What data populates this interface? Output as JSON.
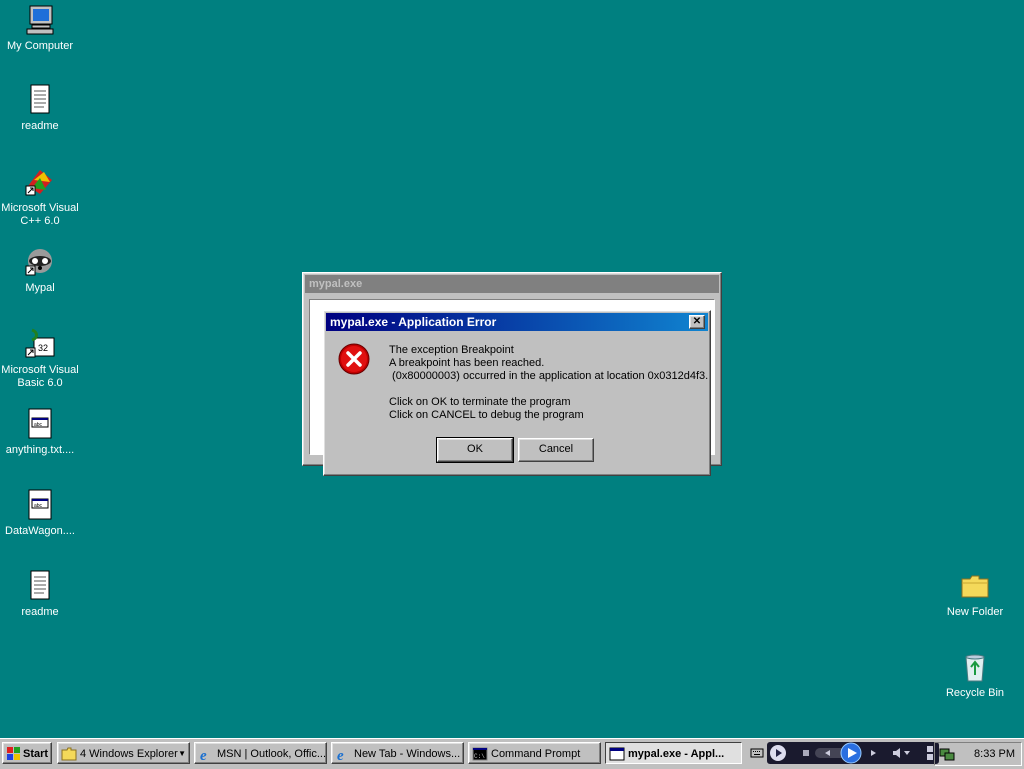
{
  "desktop": {
    "icons_left": [
      {
        "label": "My Computer",
        "icon": "computer-icon"
      },
      {
        "label": "readme",
        "icon": "text-document-icon"
      },
      {
        "label": "Microsoft Visual C++ 6.0",
        "icon": "vc-shortcut-icon"
      },
      {
        "label": "Mypal",
        "icon": "raccoon-shortcut-icon"
      },
      {
        "label": "Microsoft Visual Basic 6.0",
        "icon": "vb-shortcut-icon"
      },
      {
        "label": "anything.txt....",
        "icon": "notepad-file-icon"
      },
      {
        "label": "DataWagon....",
        "icon": "notepad-file-icon"
      },
      {
        "label": "readme",
        "icon": "text-document-icon"
      }
    ],
    "icons_right": [
      {
        "label": "New Folder",
        "icon": "folder-icon"
      },
      {
        "label": "Recycle Bin",
        "icon": "recycle-bin-icon"
      }
    ]
  },
  "background_window": {
    "title": "mypal.exe"
  },
  "error_dialog": {
    "title": "mypal.exe - Application Error",
    "lines": [
      "The exception Breakpoint",
      "A breakpoint has been reached.",
      " (0x80000003) occurred in the application at location 0x0312d4f3.",
      "",
      "Click on OK to terminate the program",
      "Click on CANCEL to debug the program"
    ],
    "ok_label": "OK",
    "cancel_label": "Cancel",
    "close_label": "✕"
  },
  "taskbar": {
    "start_label": "Start",
    "buttons": [
      {
        "label": "4 Windows Explorer",
        "icon": "folder-icon"
      },
      {
        "label": "MSN | Outlook, Offic...",
        "icon": "ie-icon"
      },
      {
        "label": "New Tab - Windows...",
        "icon": "ie-icon"
      },
      {
        "label": "Command Prompt",
        "icon": "cmd-icon"
      },
      {
        "label": "mypal.exe - Appl...",
        "icon": "window-icon"
      }
    ],
    "clock": "8:33 PM"
  },
  "colors": {
    "desktop": "#008080",
    "titlebar": "#000080",
    "face": "#c0c0c0"
  }
}
